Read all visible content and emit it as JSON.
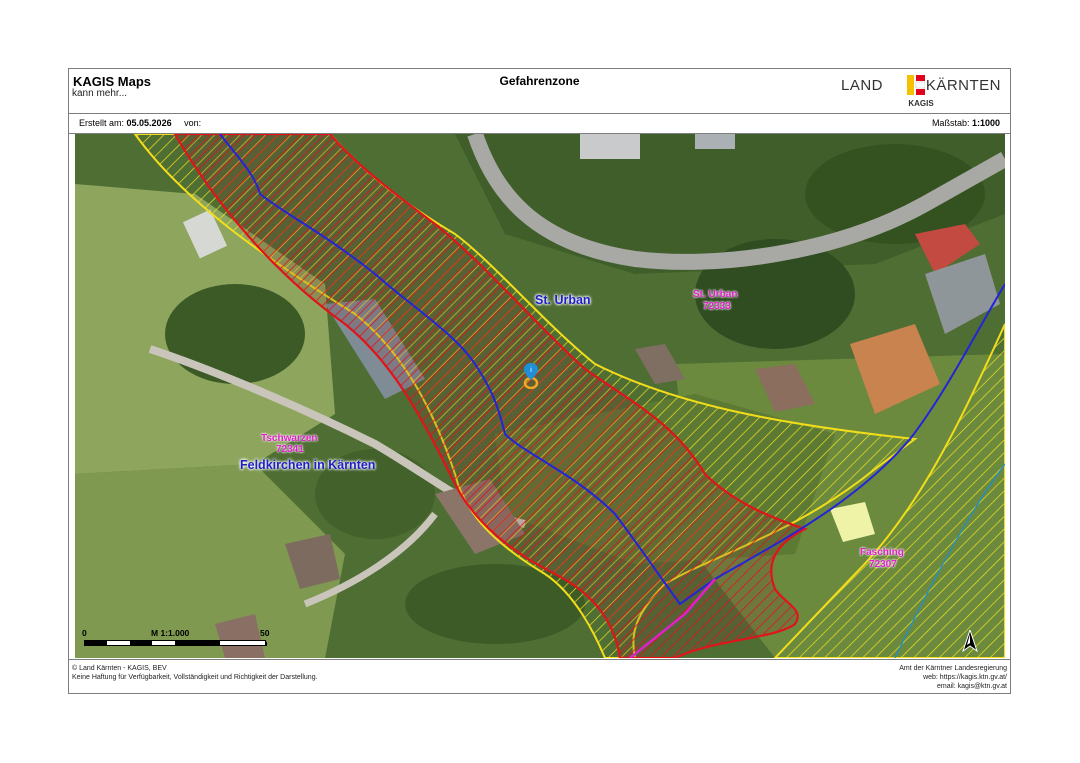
{
  "header": {
    "brand_title": "KAGIS Maps",
    "brand_subtitle": "kann mehr...",
    "document_title": "Gefahrenzone",
    "logo_left": "LAND",
    "logo_right": "KÄRNTEN",
    "logo_sub": "KAGIS"
  },
  "info": {
    "created_label": "Erstellt am:",
    "created_date": "05.05.2026",
    "by_label": "von:",
    "scale_label": "Maßstab:",
    "scale_value": "1:1000"
  },
  "map": {
    "labels": {
      "st_urban_main": "St. Urban",
      "st_urban_name": "St. Urban",
      "st_urban_code": "72333",
      "tschwarzen_name": "Tschwarzen",
      "tschwarzen_code": "72341",
      "feldkirchen": "Feldkirchen in Kärnten",
      "fasching_name": "Fasching",
      "fasching_code": "72307"
    },
    "scale_bar": {
      "start": "0",
      "middle": "M 1:1.000",
      "end": "50 m"
    },
    "marker": "location-pin-icon",
    "north_arrow": "north-arrow-icon",
    "zone_colors": {
      "red_zone": "#e0141b",
      "yellow_zone": "#f2dd1a",
      "boundary": "#2424d8",
      "magenta_line": "#e020c8"
    }
  },
  "footer": {
    "left_line1": "© Land Kärnten - KAGIS, BEV",
    "left_line2": "Keine Haftung für Verfügbarkeit, Vollständigkeit und Richtigkeit der Darstellung.",
    "right_line1": "Amt der Kärntner Landesregierung",
    "right_line2": "web: https://kagis.ktn.gv.at/",
    "right_line3": "email: kagis@ktn.gv.at"
  }
}
